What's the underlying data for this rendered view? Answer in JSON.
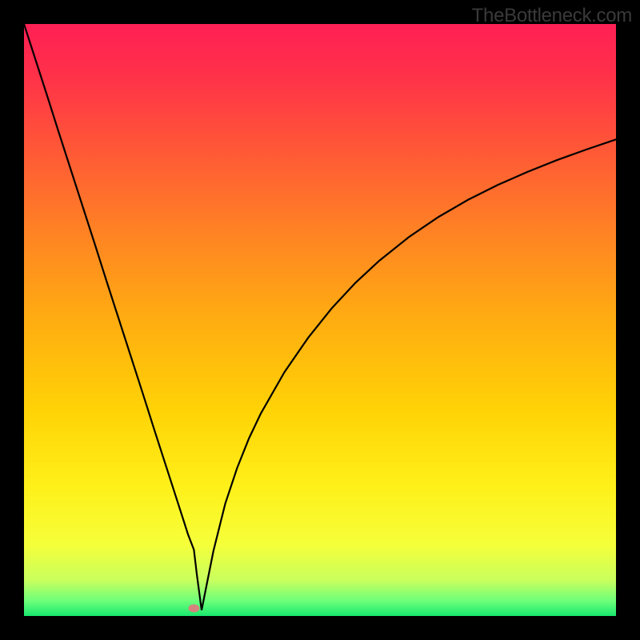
{
  "watermark": "TheBottleneck.com",
  "gradient": {
    "stops": [
      {
        "offset": 0.0,
        "color": "#ff1f55"
      },
      {
        "offset": 0.08,
        "color": "#ff2f4a"
      },
      {
        "offset": 0.2,
        "color": "#ff5438"
      },
      {
        "offset": 0.35,
        "color": "#ff8224"
      },
      {
        "offset": 0.5,
        "color": "#ffad11"
      },
      {
        "offset": 0.65,
        "color": "#ffd206"
      },
      {
        "offset": 0.78,
        "color": "#fff019"
      },
      {
        "offset": 0.88,
        "color": "#f5ff3a"
      },
      {
        "offset": 0.94,
        "color": "#c8ff5e"
      },
      {
        "offset": 0.975,
        "color": "#6bff7a"
      },
      {
        "offset": 1.0,
        "color": "#18e86e"
      }
    ]
  },
  "marker": {
    "present": true,
    "x_frac": 0.287,
    "y_frac": 0.987,
    "color": "#d6837e",
    "rx": 7,
    "ry": 5
  },
  "chart_data": {
    "type": "line",
    "title": "",
    "xlabel": "",
    "ylabel": "",
    "xlim": [
      0,
      100
    ],
    "ylim": [
      0,
      100
    ],
    "grid": false,
    "legend": false,
    "series": [
      {
        "name": "curve",
        "x": [
          0,
          2,
          4,
          6,
          8,
          10,
          12,
          14,
          16,
          18,
          20,
          22,
          24,
          25,
          26,
          27,
          27.7,
          28.7,
          29.2,
          30,
          31,
          32,
          34,
          36,
          38,
          40,
          44,
          48,
          52,
          56,
          60,
          65,
          70,
          75,
          80,
          85,
          90,
          95,
          100
        ],
        "y": [
          100,
          93.8,
          87.6,
          81.3,
          75.1,
          68.9,
          62.7,
          56.4,
          50.2,
          44.0,
          37.8,
          31.5,
          25.3,
          22.2,
          19.1,
          16.0,
          13.8,
          11.2,
          7.0,
          1.0,
          6.0,
          11.0,
          19.0,
          25.0,
          30.0,
          34.2,
          41.2,
          47.0,
          52.0,
          56.3,
          60.0,
          64.0,
          67.4,
          70.3,
          72.8,
          75.0,
          77.0,
          78.8,
          80.5
        ]
      }
    ],
    "note": "V-shaped curve; left branch descends linearly from top-left, right branch rises with decelerating slope. Minimum (marker) near x≈28.7, y≈1."
  }
}
